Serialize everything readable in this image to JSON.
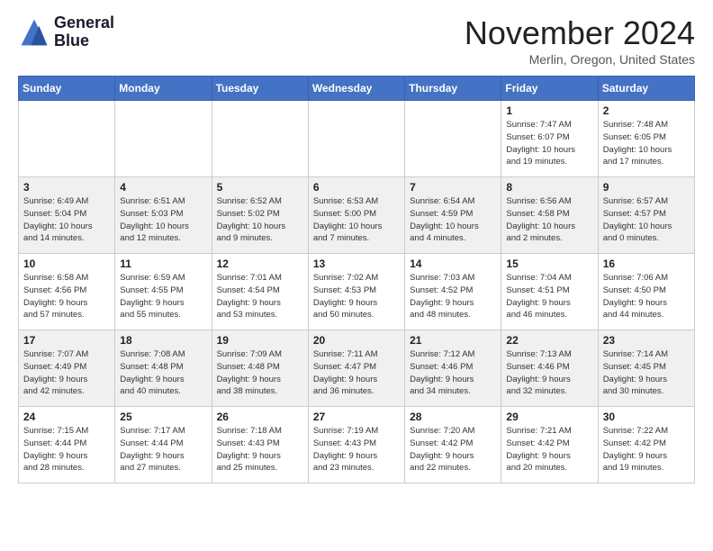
{
  "logo": {
    "line1": "General",
    "line2": "Blue"
  },
  "title": "November 2024",
  "location": "Merlin, Oregon, United States",
  "weekdays": [
    "Sunday",
    "Monday",
    "Tuesday",
    "Wednesday",
    "Thursday",
    "Friday",
    "Saturday"
  ],
  "weeks": [
    [
      {
        "day": "",
        "info": ""
      },
      {
        "day": "",
        "info": ""
      },
      {
        "day": "",
        "info": ""
      },
      {
        "day": "",
        "info": ""
      },
      {
        "day": "",
        "info": ""
      },
      {
        "day": "1",
        "info": "Sunrise: 7:47 AM\nSunset: 6:07 PM\nDaylight: 10 hours\nand 19 minutes."
      },
      {
        "day": "2",
        "info": "Sunrise: 7:48 AM\nSunset: 6:05 PM\nDaylight: 10 hours\nand 17 minutes."
      }
    ],
    [
      {
        "day": "3",
        "info": "Sunrise: 6:49 AM\nSunset: 5:04 PM\nDaylight: 10 hours\nand 14 minutes."
      },
      {
        "day": "4",
        "info": "Sunrise: 6:51 AM\nSunset: 5:03 PM\nDaylight: 10 hours\nand 12 minutes."
      },
      {
        "day": "5",
        "info": "Sunrise: 6:52 AM\nSunset: 5:02 PM\nDaylight: 10 hours\nand 9 minutes."
      },
      {
        "day": "6",
        "info": "Sunrise: 6:53 AM\nSunset: 5:00 PM\nDaylight: 10 hours\nand 7 minutes."
      },
      {
        "day": "7",
        "info": "Sunrise: 6:54 AM\nSunset: 4:59 PM\nDaylight: 10 hours\nand 4 minutes."
      },
      {
        "day": "8",
        "info": "Sunrise: 6:56 AM\nSunset: 4:58 PM\nDaylight: 10 hours\nand 2 minutes."
      },
      {
        "day": "9",
        "info": "Sunrise: 6:57 AM\nSunset: 4:57 PM\nDaylight: 10 hours\nand 0 minutes."
      }
    ],
    [
      {
        "day": "10",
        "info": "Sunrise: 6:58 AM\nSunset: 4:56 PM\nDaylight: 9 hours\nand 57 minutes."
      },
      {
        "day": "11",
        "info": "Sunrise: 6:59 AM\nSunset: 4:55 PM\nDaylight: 9 hours\nand 55 minutes."
      },
      {
        "day": "12",
        "info": "Sunrise: 7:01 AM\nSunset: 4:54 PM\nDaylight: 9 hours\nand 53 minutes."
      },
      {
        "day": "13",
        "info": "Sunrise: 7:02 AM\nSunset: 4:53 PM\nDaylight: 9 hours\nand 50 minutes."
      },
      {
        "day": "14",
        "info": "Sunrise: 7:03 AM\nSunset: 4:52 PM\nDaylight: 9 hours\nand 48 minutes."
      },
      {
        "day": "15",
        "info": "Sunrise: 7:04 AM\nSunset: 4:51 PM\nDaylight: 9 hours\nand 46 minutes."
      },
      {
        "day": "16",
        "info": "Sunrise: 7:06 AM\nSunset: 4:50 PM\nDaylight: 9 hours\nand 44 minutes."
      }
    ],
    [
      {
        "day": "17",
        "info": "Sunrise: 7:07 AM\nSunset: 4:49 PM\nDaylight: 9 hours\nand 42 minutes."
      },
      {
        "day": "18",
        "info": "Sunrise: 7:08 AM\nSunset: 4:48 PM\nDaylight: 9 hours\nand 40 minutes."
      },
      {
        "day": "19",
        "info": "Sunrise: 7:09 AM\nSunset: 4:48 PM\nDaylight: 9 hours\nand 38 minutes."
      },
      {
        "day": "20",
        "info": "Sunrise: 7:11 AM\nSunset: 4:47 PM\nDaylight: 9 hours\nand 36 minutes."
      },
      {
        "day": "21",
        "info": "Sunrise: 7:12 AM\nSunset: 4:46 PM\nDaylight: 9 hours\nand 34 minutes."
      },
      {
        "day": "22",
        "info": "Sunrise: 7:13 AM\nSunset: 4:46 PM\nDaylight: 9 hours\nand 32 minutes."
      },
      {
        "day": "23",
        "info": "Sunrise: 7:14 AM\nSunset: 4:45 PM\nDaylight: 9 hours\nand 30 minutes."
      }
    ],
    [
      {
        "day": "24",
        "info": "Sunrise: 7:15 AM\nSunset: 4:44 PM\nDaylight: 9 hours\nand 28 minutes."
      },
      {
        "day": "25",
        "info": "Sunrise: 7:17 AM\nSunset: 4:44 PM\nDaylight: 9 hours\nand 27 minutes."
      },
      {
        "day": "26",
        "info": "Sunrise: 7:18 AM\nSunset: 4:43 PM\nDaylight: 9 hours\nand 25 minutes."
      },
      {
        "day": "27",
        "info": "Sunrise: 7:19 AM\nSunset: 4:43 PM\nDaylight: 9 hours\nand 23 minutes."
      },
      {
        "day": "28",
        "info": "Sunrise: 7:20 AM\nSunset: 4:42 PM\nDaylight: 9 hours\nand 22 minutes."
      },
      {
        "day": "29",
        "info": "Sunrise: 7:21 AM\nSunset: 4:42 PM\nDaylight: 9 hours\nand 20 minutes."
      },
      {
        "day": "30",
        "info": "Sunrise: 7:22 AM\nSunset: 4:42 PM\nDaylight: 9 hours\nand 19 minutes."
      }
    ]
  ]
}
